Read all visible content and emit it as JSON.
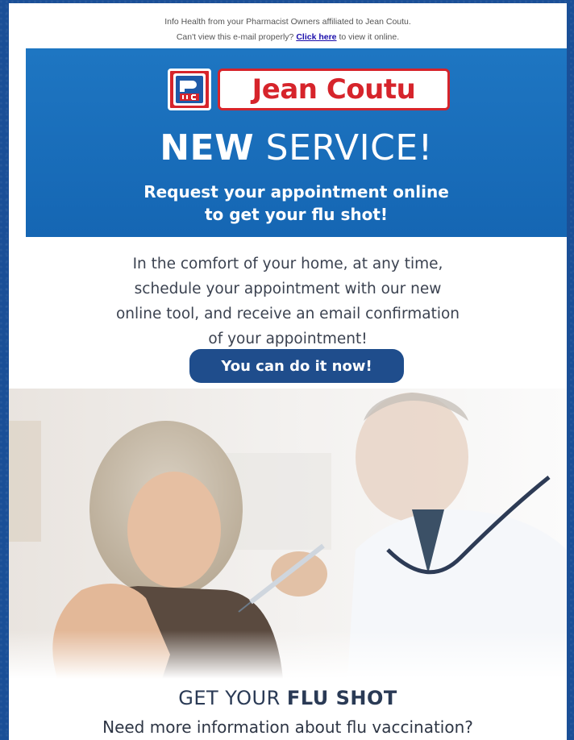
{
  "preheader": {
    "line1": "Info Health from your Pharmacist Owners affiliated to Jean Coutu.",
    "line2_prefix": "Can't view this e-mail properly?",
    "link_text": "Click here",
    "line2_suffix": "to view it online."
  },
  "logo": {
    "mark_text": "PJC",
    "wordmark": "Jean Coutu",
    "mark_icon": "pjc-logo-icon"
  },
  "banner": {
    "headline_bold": "NEW",
    "headline_light": "SERVICE!",
    "subhead_line1": "Request your appointment online",
    "subhead_line2": "to get your flu shot!"
  },
  "intro": {
    "line1": "In the comfort of your home, at any time,",
    "line2": "schedule your appointment with our new",
    "line3": "online tool, and receive an email confirmation",
    "line4": "of your appointment!"
  },
  "cta": {
    "label": "You can do it now!"
  },
  "section": {
    "title_light": "GET YOUR",
    "title_bold": "FLU SHOT",
    "subtitle": "Need more information about flu vaccination?"
  },
  "colors": {
    "page_background": "#1a4f97",
    "banner_blue": "#1e76c2",
    "cta_navy": "#1f4d8c",
    "brand_red": "#d6242b"
  }
}
